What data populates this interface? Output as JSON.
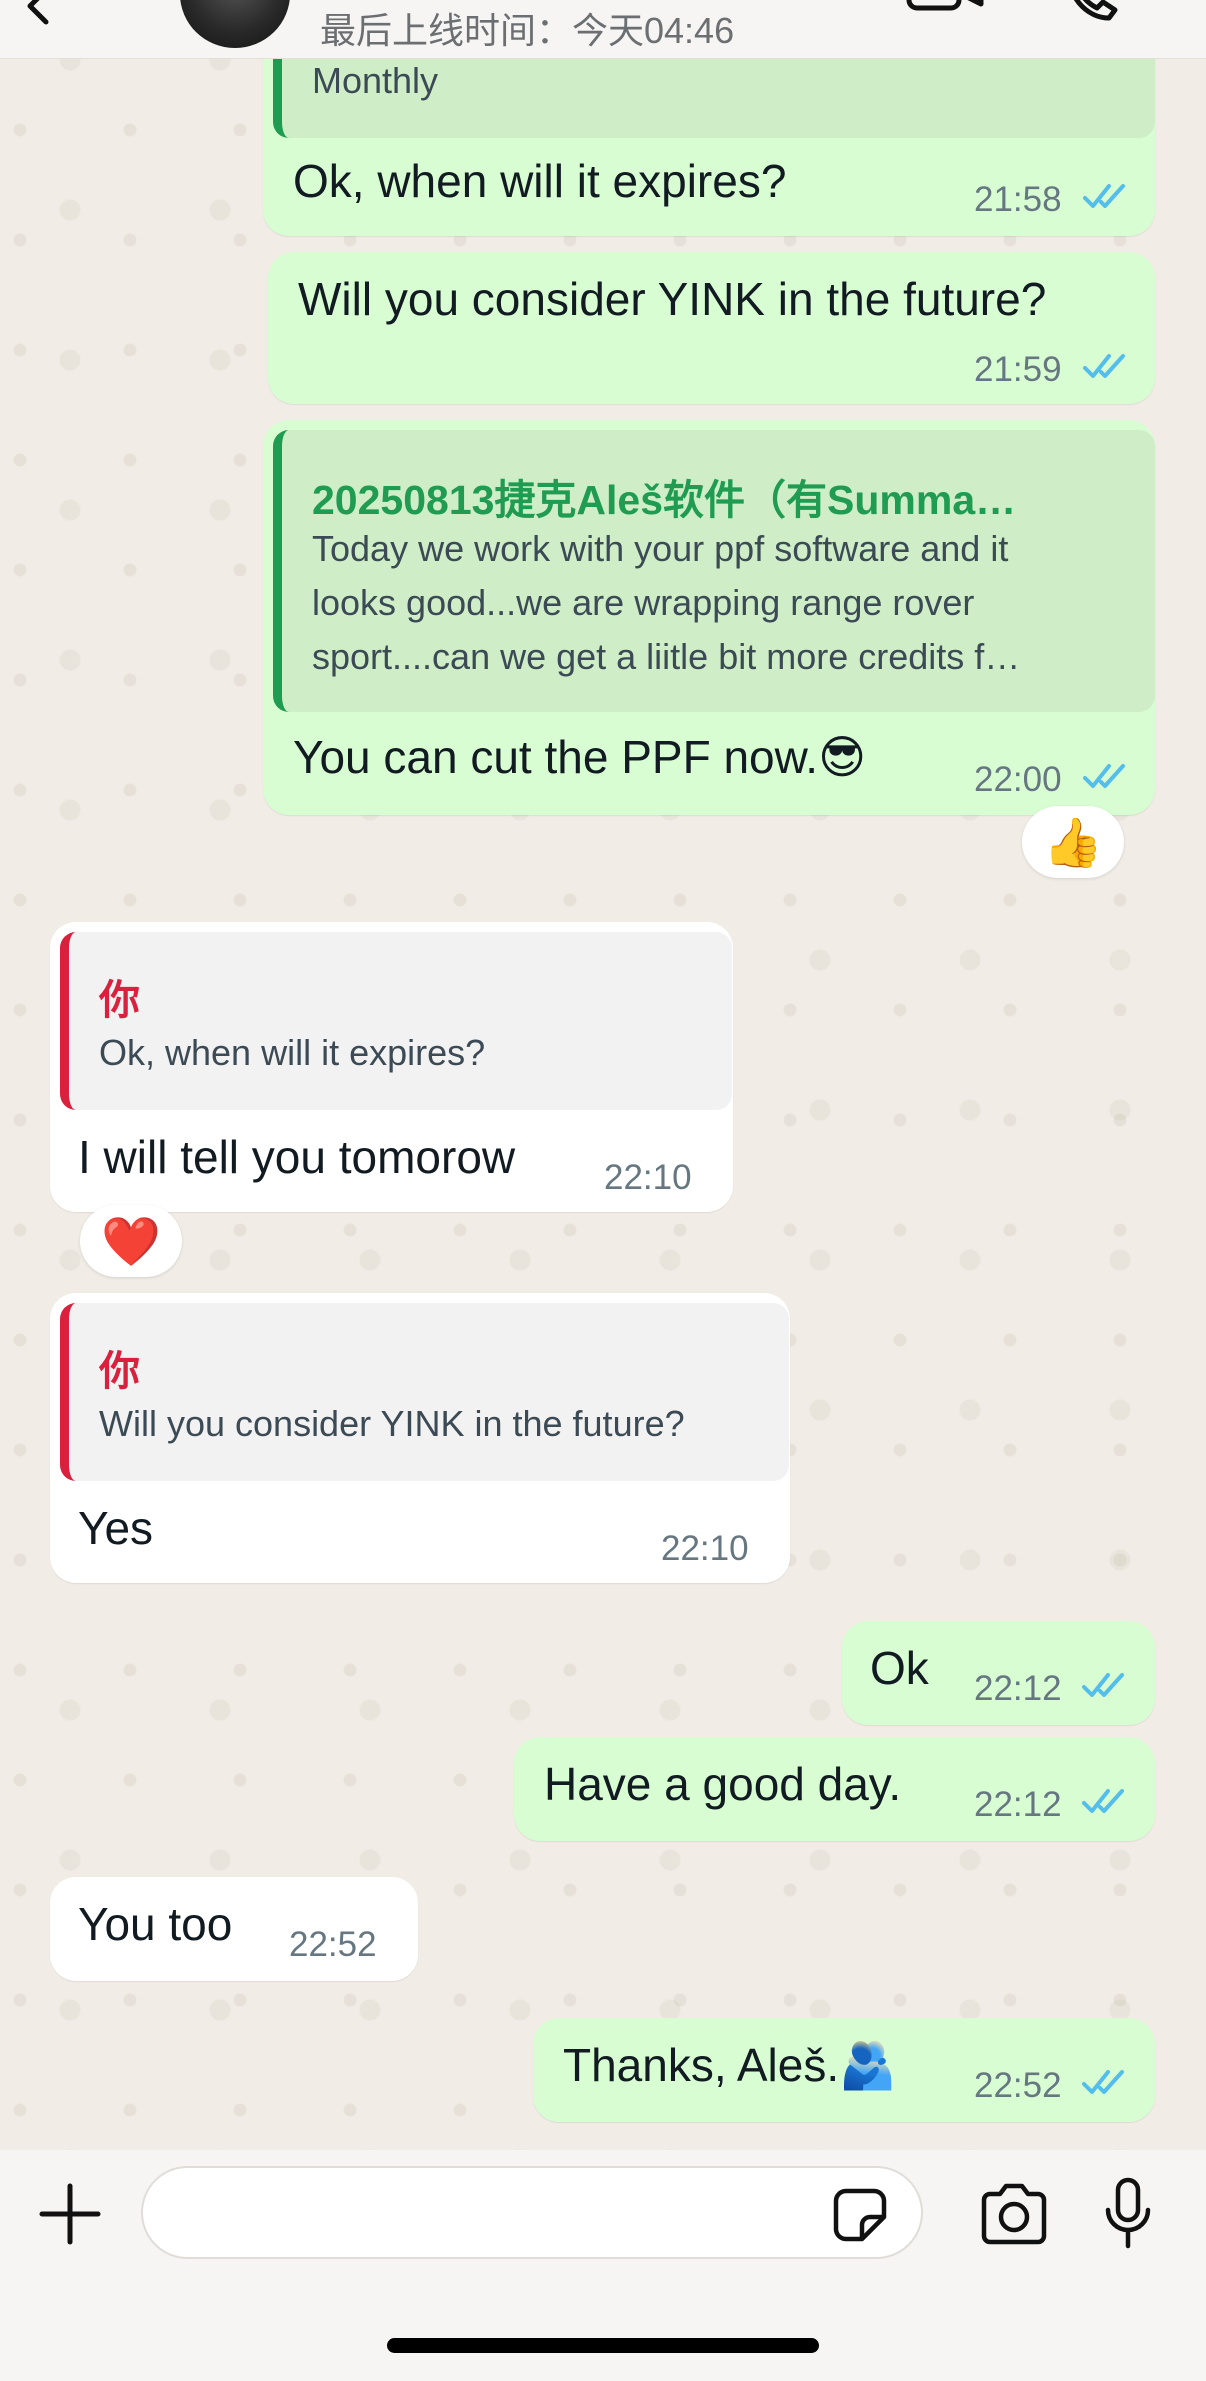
{
  "header": {
    "last_seen": "最后上线时间：今天04:46"
  },
  "messages": [
    {
      "id": "m1",
      "direction": "out",
      "quote_text": "Monthly",
      "text": "Ok, when will it expires?",
      "time": "21:58",
      "status": "read"
    },
    {
      "id": "m2",
      "direction": "out",
      "text": "Will you consider YINK in the future?",
      "time": "21:59",
      "status": "read"
    },
    {
      "id": "m3",
      "direction": "out",
      "quote_author": "20250813捷克Aleš软件（有Summa…",
      "quote_lines": [
        "Today we work with your ppf software and it",
        "looks good...we are wrapping range rover",
        "sport....can we get a liitle bit more credits f…"
      ],
      "text": "You can cut the PPF now.😎",
      "time": "22:00",
      "status": "read",
      "reaction": "👍"
    },
    {
      "id": "m4",
      "direction": "in",
      "quote_author": "你",
      "quote_text": "Ok, when will it expires?",
      "text": "I will tell you tomorow",
      "time": "22:10",
      "reaction": "❤️"
    },
    {
      "id": "m5",
      "direction": "in",
      "quote_author": "你",
      "quote_text": "Will you consider YINK in the future?",
      "text": "Yes",
      "time": "22:10"
    },
    {
      "id": "m6",
      "direction": "out",
      "text": "Ok",
      "time": "22:12",
      "status": "read"
    },
    {
      "id": "m7",
      "direction": "out",
      "text": "Have a good day.",
      "time": "22:12",
      "status": "read"
    },
    {
      "id": "m8",
      "direction": "in",
      "text": "You too",
      "time": "22:52"
    },
    {
      "id": "m9",
      "direction": "out",
      "text": "Thanks, Aleš.🫂",
      "time": "22:52",
      "status": "read"
    }
  ],
  "composer": {
    "placeholder": ""
  },
  "icons": {
    "back": "chevron-left-icon",
    "video": "video-call-icon",
    "call": "phone-icon",
    "plus": "plus-icon",
    "sticker": "sticker-icon",
    "camera": "camera-icon",
    "mic": "microphone-icon",
    "read_receipt": "double-check-icon"
  },
  "colors": {
    "outgoing_bubble": "#d9fdd3",
    "incoming_bubble": "#ffffff",
    "read_ticks": "#53bdeb",
    "quote_self": "#d9213e",
    "quote_forward": "#1f9b52",
    "chat_background": "#efeae2"
  }
}
